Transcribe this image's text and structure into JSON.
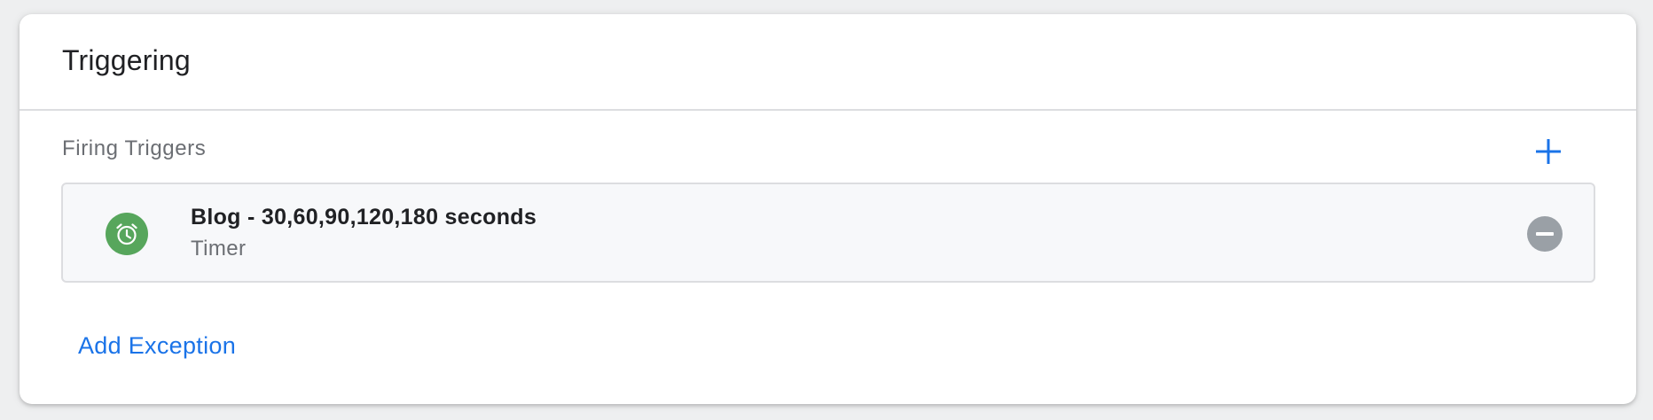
{
  "panel": {
    "title": "Triggering"
  },
  "firing_triggers": {
    "label": "Firing Triggers",
    "add_icon": "plus-icon",
    "items": [
      {
        "name": "Blog - 30,60,90,120,180 seconds",
        "type": "Timer",
        "icon": "timer-alarm-clock-icon",
        "icon_color": "#57a65c",
        "remove_icon": "remove-circle-icon"
      }
    ]
  },
  "exceptions": {
    "add_label": "Add Exception"
  },
  "colors": {
    "accent": "#1a73e8",
    "timer_green": "#57a65c",
    "remove_grey": "#9aa0a6"
  }
}
